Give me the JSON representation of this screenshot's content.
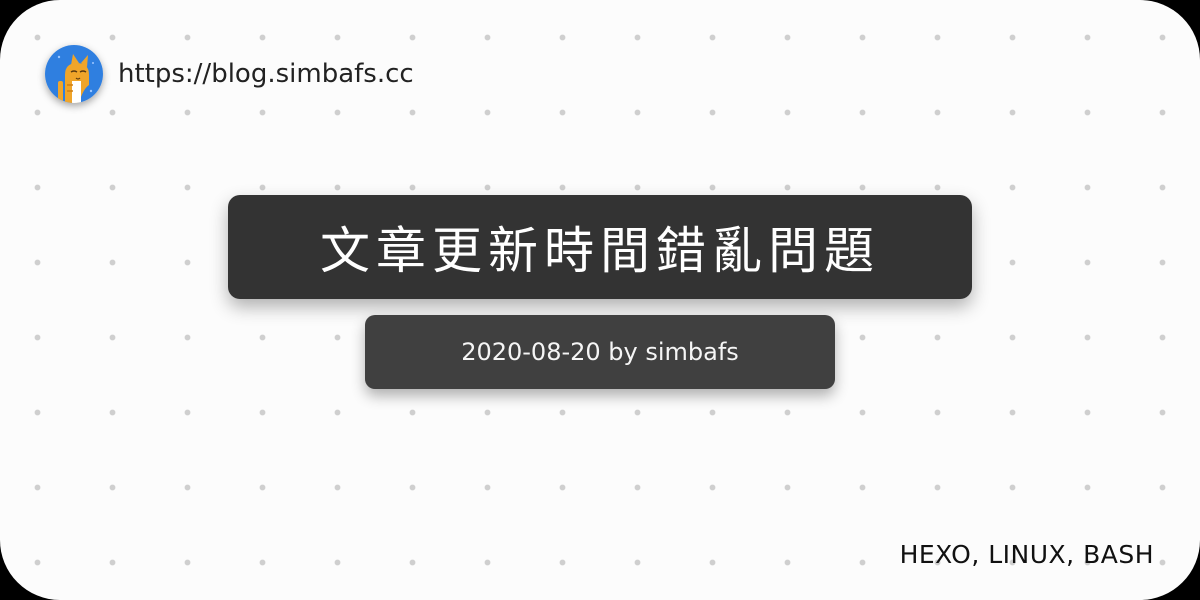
{
  "site": {
    "url": "https://blog.simbafs.cc",
    "avatar_icon": "cat-avatar-icon"
  },
  "post": {
    "title": "文章更新時間錯亂問題",
    "meta": "2020-08-20 by simbafs",
    "tags": "HEXO, LINUX, BASH"
  },
  "colors": {
    "background": "#fcfcfc",
    "dots": "#cfcfcf",
    "title_box": "#333333",
    "meta_box": "#404040",
    "avatar_bg": "#2f7fe0",
    "cat": "#f0a52a"
  }
}
